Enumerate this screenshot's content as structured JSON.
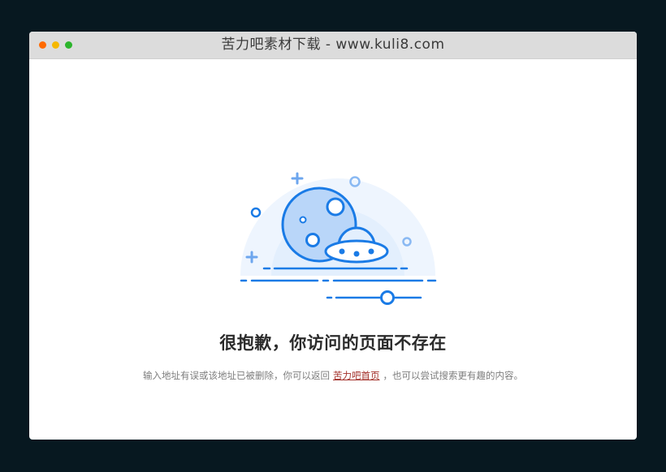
{
  "window": {
    "title": "苦力吧素材下载 - www.kuli8.com",
    "controls": [
      {
        "name": "close",
        "color": "#ff6a00"
      },
      {
        "name": "minimize",
        "color": "#f5b800"
      },
      {
        "name": "zoom",
        "color": "#2cb52c"
      }
    ]
  },
  "error_page": {
    "headline": "很抱歉，你访问的页面不存在",
    "message_before": "输入地址有误或该地址已被删除，你可以返回",
    "home_link": "苦力吧首页",
    "message_after": "，也可以尝试搜索更有趣的内容。",
    "illustration_icon": "ufo-moon-icon"
  },
  "colors": {
    "background": "#071820",
    "accent": "#1a7be6",
    "link": "#a3302a"
  }
}
